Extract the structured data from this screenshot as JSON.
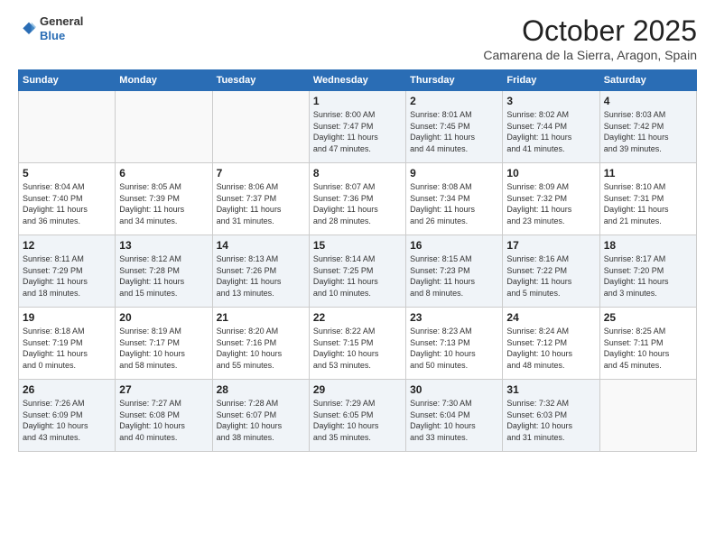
{
  "header": {
    "logo_line1": "General",
    "logo_line2": "Blue",
    "month": "October 2025",
    "location": "Camarena de la Sierra, Aragon, Spain"
  },
  "days_of_week": [
    "Sunday",
    "Monday",
    "Tuesday",
    "Wednesday",
    "Thursday",
    "Friday",
    "Saturday"
  ],
  "weeks": [
    [
      {
        "day": "",
        "content": ""
      },
      {
        "day": "",
        "content": ""
      },
      {
        "day": "",
        "content": ""
      },
      {
        "day": "1",
        "content": "Sunrise: 8:00 AM\nSunset: 7:47 PM\nDaylight: 11 hours\nand 47 minutes."
      },
      {
        "day": "2",
        "content": "Sunrise: 8:01 AM\nSunset: 7:45 PM\nDaylight: 11 hours\nand 44 minutes."
      },
      {
        "day": "3",
        "content": "Sunrise: 8:02 AM\nSunset: 7:44 PM\nDaylight: 11 hours\nand 41 minutes."
      },
      {
        "day": "4",
        "content": "Sunrise: 8:03 AM\nSunset: 7:42 PM\nDaylight: 11 hours\nand 39 minutes."
      }
    ],
    [
      {
        "day": "5",
        "content": "Sunrise: 8:04 AM\nSunset: 7:40 PM\nDaylight: 11 hours\nand 36 minutes."
      },
      {
        "day": "6",
        "content": "Sunrise: 8:05 AM\nSunset: 7:39 PM\nDaylight: 11 hours\nand 34 minutes."
      },
      {
        "day": "7",
        "content": "Sunrise: 8:06 AM\nSunset: 7:37 PM\nDaylight: 11 hours\nand 31 minutes."
      },
      {
        "day": "8",
        "content": "Sunrise: 8:07 AM\nSunset: 7:36 PM\nDaylight: 11 hours\nand 28 minutes."
      },
      {
        "day": "9",
        "content": "Sunrise: 8:08 AM\nSunset: 7:34 PM\nDaylight: 11 hours\nand 26 minutes."
      },
      {
        "day": "10",
        "content": "Sunrise: 8:09 AM\nSunset: 7:32 PM\nDaylight: 11 hours\nand 23 minutes."
      },
      {
        "day": "11",
        "content": "Sunrise: 8:10 AM\nSunset: 7:31 PM\nDaylight: 11 hours\nand 21 minutes."
      }
    ],
    [
      {
        "day": "12",
        "content": "Sunrise: 8:11 AM\nSunset: 7:29 PM\nDaylight: 11 hours\nand 18 minutes."
      },
      {
        "day": "13",
        "content": "Sunrise: 8:12 AM\nSunset: 7:28 PM\nDaylight: 11 hours\nand 15 minutes."
      },
      {
        "day": "14",
        "content": "Sunrise: 8:13 AM\nSunset: 7:26 PM\nDaylight: 11 hours\nand 13 minutes."
      },
      {
        "day": "15",
        "content": "Sunrise: 8:14 AM\nSunset: 7:25 PM\nDaylight: 11 hours\nand 10 minutes."
      },
      {
        "day": "16",
        "content": "Sunrise: 8:15 AM\nSunset: 7:23 PM\nDaylight: 11 hours\nand 8 minutes."
      },
      {
        "day": "17",
        "content": "Sunrise: 8:16 AM\nSunset: 7:22 PM\nDaylight: 11 hours\nand 5 minutes."
      },
      {
        "day": "18",
        "content": "Sunrise: 8:17 AM\nSunset: 7:20 PM\nDaylight: 11 hours\nand 3 minutes."
      }
    ],
    [
      {
        "day": "19",
        "content": "Sunrise: 8:18 AM\nSunset: 7:19 PM\nDaylight: 11 hours\nand 0 minutes."
      },
      {
        "day": "20",
        "content": "Sunrise: 8:19 AM\nSunset: 7:17 PM\nDaylight: 10 hours\nand 58 minutes."
      },
      {
        "day": "21",
        "content": "Sunrise: 8:20 AM\nSunset: 7:16 PM\nDaylight: 10 hours\nand 55 minutes."
      },
      {
        "day": "22",
        "content": "Sunrise: 8:22 AM\nSunset: 7:15 PM\nDaylight: 10 hours\nand 53 minutes."
      },
      {
        "day": "23",
        "content": "Sunrise: 8:23 AM\nSunset: 7:13 PM\nDaylight: 10 hours\nand 50 minutes."
      },
      {
        "day": "24",
        "content": "Sunrise: 8:24 AM\nSunset: 7:12 PM\nDaylight: 10 hours\nand 48 minutes."
      },
      {
        "day": "25",
        "content": "Sunrise: 8:25 AM\nSunset: 7:11 PM\nDaylight: 10 hours\nand 45 minutes."
      }
    ],
    [
      {
        "day": "26",
        "content": "Sunrise: 7:26 AM\nSunset: 6:09 PM\nDaylight: 10 hours\nand 43 minutes."
      },
      {
        "day": "27",
        "content": "Sunrise: 7:27 AM\nSunset: 6:08 PM\nDaylight: 10 hours\nand 40 minutes."
      },
      {
        "day": "28",
        "content": "Sunrise: 7:28 AM\nSunset: 6:07 PM\nDaylight: 10 hours\nand 38 minutes."
      },
      {
        "day": "29",
        "content": "Sunrise: 7:29 AM\nSunset: 6:05 PM\nDaylight: 10 hours\nand 35 minutes."
      },
      {
        "day": "30",
        "content": "Sunrise: 7:30 AM\nSunset: 6:04 PM\nDaylight: 10 hours\nand 33 minutes."
      },
      {
        "day": "31",
        "content": "Sunrise: 7:32 AM\nSunset: 6:03 PM\nDaylight: 10 hours\nand 31 minutes."
      },
      {
        "day": "",
        "content": ""
      }
    ]
  ]
}
